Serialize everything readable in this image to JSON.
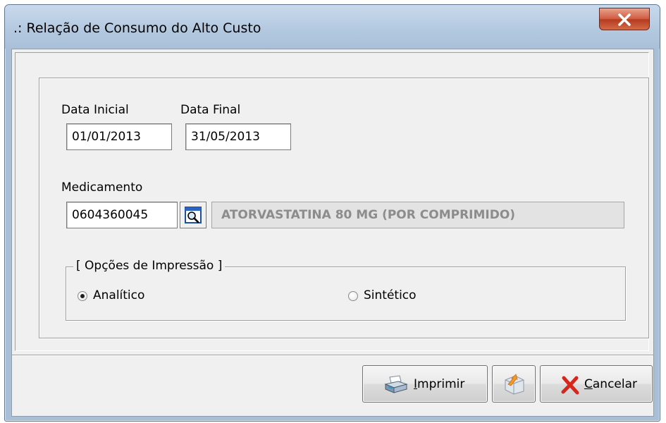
{
  "window": {
    "title": ".: Relação de Consumo do Alto Custo"
  },
  "form": {
    "data_inicial_label": "Data Inicial",
    "data_inicial_value": "01/01/2013",
    "data_final_label": "Data Final",
    "data_final_value": "31/05/2013",
    "medicamento_label": "Medicamento",
    "medicamento_code": "0604360045",
    "medicamento_desc": "ATORVASTATINA 80 MG (POR COMPRIMIDO)"
  },
  "print_options": {
    "legend": "[ Opções de Impressão ]",
    "options": [
      {
        "label": "Analítico",
        "checked": true
      },
      {
        "label": "Sintético",
        "checked": false
      }
    ]
  },
  "buttons": {
    "imprimir_first": "I",
    "imprimir_rest": "mprimir",
    "cancelar_first": "C",
    "cancelar_rest": "ancelar"
  },
  "icons": [
    "close-icon",
    "magnifier-icon",
    "printer-icon",
    "export-icon",
    "cancel-x-icon"
  ]
}
